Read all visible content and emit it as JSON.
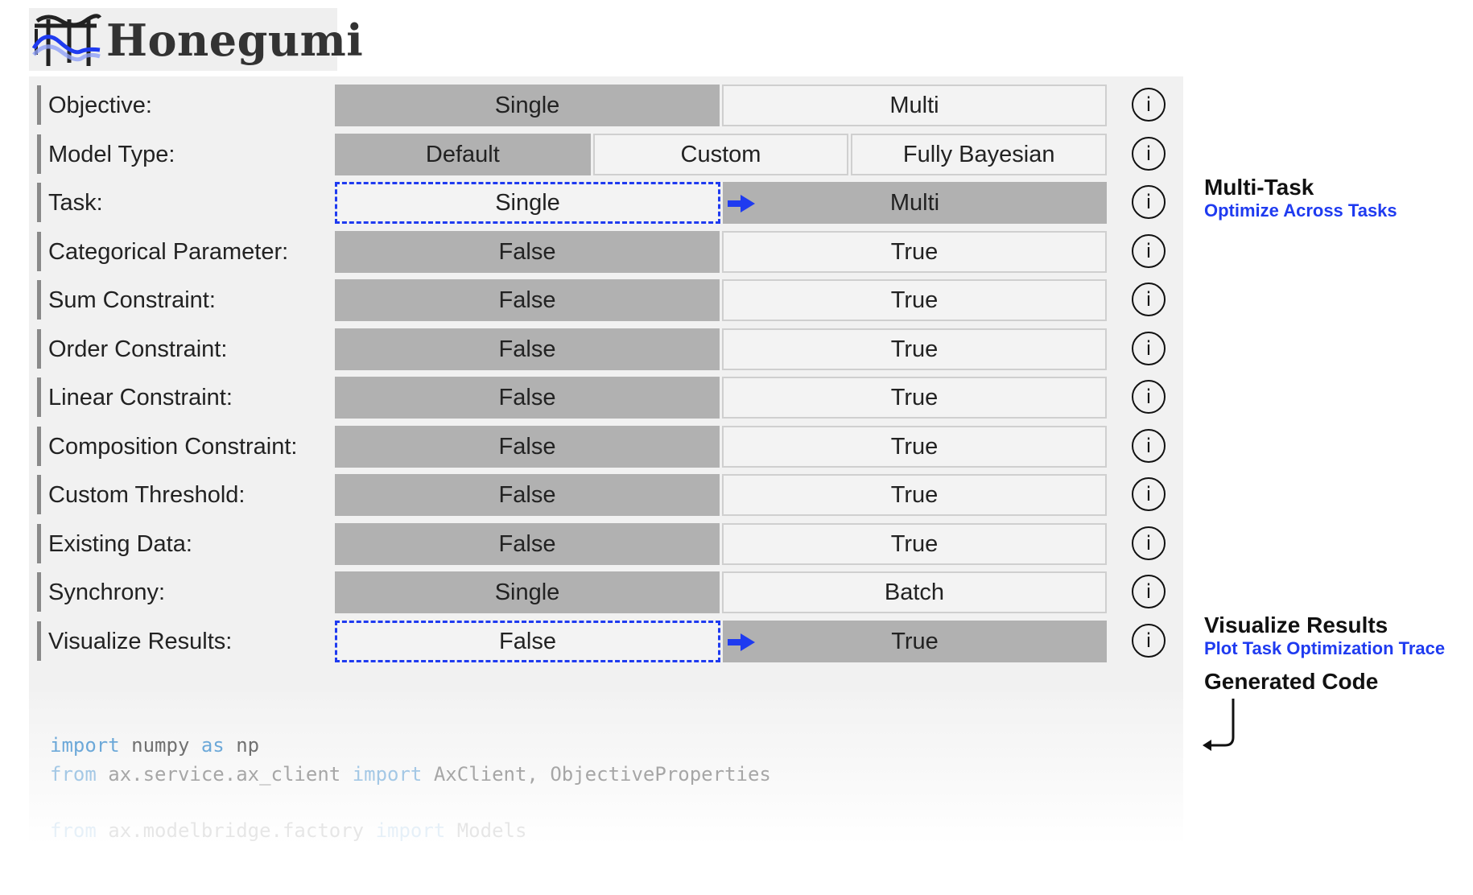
{
  "app": {
    "name": "Honegumi"
  },
  "rows": [
    {
      "label": "Objective:",
      "options": [
        "Single",
        "Multi"
      ],
      "selected": 0
    },
    {
      "label": "Model Type:",
      "options": [
        "Default",
        "Custom",
        "Fully Bayesian"
      ],
      "selected": 0
    },
    {
      "label": "Task:",
      "options": [
        "Single",
        "Multi"
      ],
      "selected": 1,
      "changed_from": 0
    },
    {
      "label": "Categorical Parameter:",
      "options": [
        "False",
        "True"
      ],
      "selected": 0
    },
    {
      "label": "Sum Constraint:",
      "options": [
        "False",
        "True"
      ],
      "selected": 0
    },
    {
      "label": "Order Constraint:",
      "options": [
        "False",
        "True"
      ],
      "selected": 0
    },
    {
      "label": "Linear Constraint:",
      "options": [
        "False",
        "True"
      ],
      "selected": 0
    },
    {
      "label": "Composition Constraint:",
      "options": [
        "False",
        "True"
      ],
      "selected": 0
    },
    {
      "label": "Custom Threshold:",
      "options": [
        "False",
        "True"
      ],
      "selected": 0
    },
    {
      "label": "Existing Data:",
      "options": [
        "False",
        "True"
      ],
      "selected": 0
    },
    {
      "label": "Synchrony:",
      "options": [
        "Single",
        "Batch"
      ],
      "selected": 0
    },
    {
      "label": "Visualize Results:",
      "options": [
        "False",
        "True"
      ],
      "selected": 1,
      "changed_from": 0
    }
  ],
  "info_icon": "info-icon",
  "notes": {
    "multi_task": {
      "title": "Multi-Task",
      "subtitle": "Optimize Across Tasks"
    },
    "visualize": {
      "title": "Visualize Results",
      "subtitle": "Plot Task Optimization Trace"
    },
    "code_label": {
      "title": "Generated Code"
    }
  },
  "code": {
    "line1": {
      "kw1": "import",
      "t1": " numpy ",
      "kw2": "as",
      "t2": " np"
    },
    "line2": {
      "kw1": "from",
      "t1": " ax.service.ax_client ",
      "kw2": "import",
      "t2": " AxClient, ObjectiveProperties"
    },
    "line3": {
      "kw1": "from",
      "t1": " ax.modelbridge.factory ",
      "kw2": "import",
      "t2": " Models"
    }
  },
  "colors": {
    "accent": "#1f3bf0",
    "selected": "#b1b1b1",
    "unselected": "#f3f3f3",
    "panel": "#f1f1f1"
  }
}
